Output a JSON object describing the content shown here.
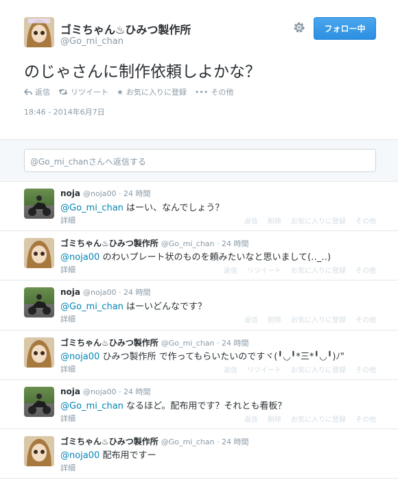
{
  "main_tweet": {
    "display_name": "ゴミちゃん♨ひみつ製作所",
    "screen_name": "@Go_mi_chan",
    "follow_label": "フォロー中",
    "text": "のじゃさんに制作依頼しよかな？",
    "actions": {
      "reply": "返信",
      "retweet": "リツイート",
      "favorite": "お気に入りに登録",
      "more": "その他"
    },
    "timestamp": "18:46 - 2014年6月7日"
  },
  "reply_box": {
    "placeholder": "@Go_mi_chanさんへ返信する"
  },
  "replies": [
    {
      "name": "noja",
      "meta": "@noja00 · 24 時間",
      "mention": "@Go_mi_chan",
      "text": " はーい、なんでしょう？",
      "detail": "詳細",
      "avatar": "motorcycle"
    },
    {
      "name": "ゴミちゃん♨ひみつ製作所",
      "meta": "@Go_mi_chan · 24 時間",
      "mention": "@noja00",
      "text": " のわいプレート状のものを頼みたいなと思いまして(‥_‥)",
      "detail": "詳細",
      "avatar": "doll"
    },
    {
      "name": "noja",
      "meta": "@noja00 · 24 時間",
      "mention": "@Go_mi_chan",
      "text": " はーいどんなです？",
      "detail": "詳細",
      "avatar": "motorcycle"
    },
    {
      "name": "ゴミちゃん♨ひみつ製作所",
      "meta": "@Go_mi_chan · 24 時間",
      "mention": "@noja00",
      "text": " ひみつ製作所 で作ってもらいたいのですヾ(╹◡╹*三*╹◡╹)ﾉ\"",
      "detail": "詳細",
      "avatar": "doll"
    },
    {
      "name": "noja",
      "meta": "@noja00 · 24 時間",
      "mention": "@Go_mi_chan",
      "text": " なるほど。配布用です？それとも看板？",
      "detail": "詳細",
      "avatar": "motorcycle"
    },
    {
      "name": "ゴミちゃん♨ひみつ製作所",
      "meta": "@Go_mi_chan · 24 時間",
      "mention": "@noja00",
      "text": " 配布用ですー",
      "detail": "詳細",
      "avatar": "doll"
    }
  ],
  "reply_actions": {
    "reply": "返信",
    "delete": "削除",
    "retweet": "リツイート",
    "favorite": "お気に入りに登録",
    "more": "その他"
  },
  "colors": {
    "accent": "#2c8fe0",
    "link": "#0084b4",
    "muted": "#8899a6"
  }
}
